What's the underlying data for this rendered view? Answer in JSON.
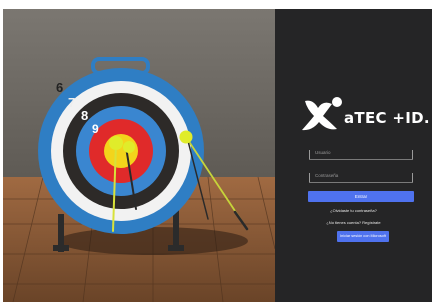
{
  "brand": {
    "name": "aTEC +ID.",
    "text_color": "#ffffff"
  },
  "form": {
    "username_placeholder": "Usuario",
    "password_placeholder": "Contraseña",
    "submit_label": "Entrar",
    "forgot_password_link": "¿Olvidaste tu contraseña?",
    "register_link": "¿No tienes cuenta? Regístrate",
    "secondary_button_label": "Iniciar sesión con Microsoft",
    "accent_color": "#4f72ee"
  },
  "background_image": {
    "target_ring_numbers": [
      "6",
      "7",
      "8",
      "9"
    ]
  }
}
